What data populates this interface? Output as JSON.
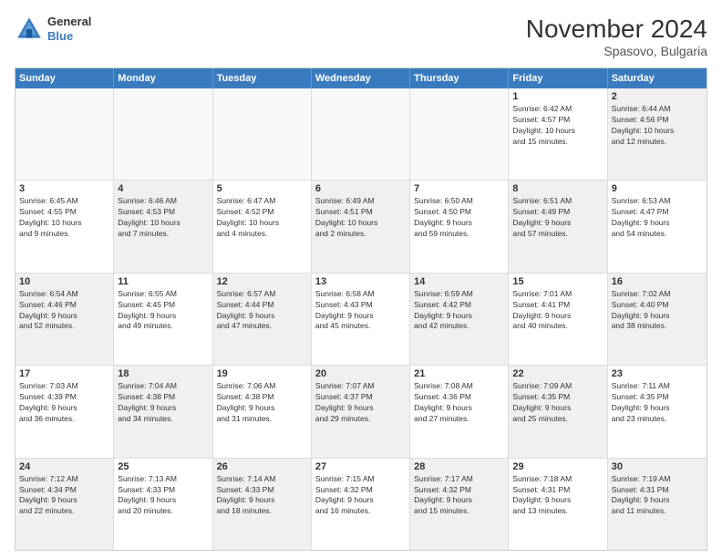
{
  "header": {
    "logo": {
      "general": "General",
      "blue": "Blue"
    },
    "title": "November 2024",
    "subtitle": "Spasovo, Bulgaria"
  },
  "weekdays": [
    "Sunday",
    "Monday",
    "Tuesday",
    "Wednesday",
    "Thursday",
    "Friday",
    "Saturday"
  ],
  "rows": [
    [
      {
        "day": "",
        "info": "",
        "empty": true
      },
      {
        "day": "",
        "info": "",
        "empty": true
      },
      {
        "day": "",
        "info": "",
        "empty": true
      },
      {
        "day": "",
        "info": "",
        "empty": true
      },
      {
        "day": "",
        "info": "",
        "empty": true
      },
      {
        "day": "1",
        "info": "Sunrise: 6:42 AM\nSunset: 4:57 PM\nDaylight: 10 hours\nand 15 minutes.",
        "empty": false
      },
      {
        "day": "2",
        "info": "Sunrise: 6:44 AM\nSunset: 4:56 PM\nDaylight: 10 hours\nand 12 minutes.",
        "empty": false,
        "shaded": true
      }
    ],
    [
      {
        "day": "3",
        "info": "Sunrise: 6:45 AM\nSunset: 4:55 PM\nDaylight: 10 hours\nand 9 minutes.",
        "empty": false
      },
      {
        "day": "4",
        "info": "Sunrise: 6:46 AM\nSunset: 4:53 PM\nDaylight: 10 hours\nand 7 minutes.",
        "empty": false,
        "shaded": true
      },
      {
        "day": "5",
        "info": "Sunrise: 6:47 AM\nSunset: 4:52 PM\nDaylight: 10 hours\nand 4 minutes.",
        "empty": false
      },
      {
        "day": "6",
        "info": "Sunrise: 6:49 AM\nSunset: 4:51 PM\nDaylight: 10 hours\nand 2 minutes.",
        "empty": false,
        "shaded": true
      },
      {
        "day": "7",
        "info": "Sunrise: 6:50 AM\nSunset: 4:50 PM\nDaylight: 9 hours\nand 59 minutes.",
        "empty": false
      },
      {
        "day": "8",
        "info": "Sunrise: 6:51 AM\nSunset: 4:49 PM\nDaylight: 9 hours\nand 57 minutes.",
        "empty": false,
        "shaded": true
      },
      {
        "day": "9",
        "info": "Sunrise: 6:53 AM\nSunset: 4:47 PM\nDaylight: 9 hours\nand 54 minutes.",
        "empty": false
      }
    ],
    [
      {
        "day": "10",
        "info": "Sunrise: 6:54 AM\nSunset: 4:46 PM\nDaylight: 9 hours\nand 52 minutes.",
        "empty": false,
        "shaded": true
      },
      {
        "day": "11",
        "info": "Sunrise: 6:55 AM\nSunset: 4:45 PM\nDaylight: 9 hours\nand 49 minutes.",
        "empty": false
      },
      {
        "day": "12",
        "info": "Sunrise: 6:57 AM\nSunset: 4:44 PM\nDaylight: 9 hours\nand 47 minutes.",
        "empty": false,
        "shaded": true
      },
      {
        "day": "13",
        "info": "Sunrise: 6:58 AM\nSunset: 4:43 PM\nDaylight: 9 hours\nand 45 minutes.",
        "empty": false
      },
      {
        "day": "14",
        "info": "Sunrise: 6:59 AM\nSunset: 4:42 PM\nDaylight: 9 hours\nand 42 minutes.",
        "empty": false,
        "shaded": true
      },
      {
        "day": "15",
        "info": "Sunrise: 7:01 AM\nSunset: 4:41 PM\nDaylight: 9 hours\nand 40 minutes.",
        "empty": false
      },
      {
        "day": "16",
        "info": "Sunrise: 7:02 AM\nSunset: 4:40 PM\nDaylight: 9 hours\nand 38 minutes.",
        "empty": false,
        "shaded": true
      }
    ],
    [
      {
        "day": "17",
        "info": "Sunrise: 7:03 AM\nSunset: 4:39 PM\nDaylight: 9 hours\nand 36 minutes.",
        "empty": false
      },
      {
        "day": "18",
        "info": "Sunrise: 7:04 AM\nSunset: 4:38 PM\nDaylight: 9 hours\nand 34 minutes.",
        "empty": false,
        "shaded": true
      },
      {
        "day": "19",
        "info": "Sunrise: 7:06 AM\nSunset: 4:38 PM\nDaylight: 9 hours\nand 31 minutes.",
        "empty": false
      },
      {
        "day": "20",
        "info": "Sunrise: 7:07 AM\nSunset: 4:37 PM\nDaylight: 9 hours\nand 29 minutes.",
        "empty": false,
        "shaded": true
      },
      {
        "day": "21",
        "info": "Sunrise: 7:08 AM\nSunset: 4:36 PM\nDaylight: 9 hours\nand 27 minutes.",
        "empty": false
      },
      {
        "day": "22",
        "info": "Sunrise: 7:09 AM\nSunset: 4:35 PM\nDaylight: 9 hours\nand 25 minutes.",
        "empty": false,
        "shaded": true
      },
      {
        "day": "23",
        "info": "Sunrise: 7:11 AM\nSunset: 4:35 PM\nDaylight: 9 hours\nand 23 minutes.",
        "empty": false
      }
    ],
    [
      {
        "day": "24",
        "info": "Sunrise: 7:12 AM\nSunset: 4:34 PM\nDaylight: 9 hours\nand 22 minutes.",
        "empty": false,
        "shaded": true
      },
      {
        "day": "25",
        "info": "Sunrise: 7:13 AM\nSunset: 4:33 PM\nDaylight: 9 hours\nand 20 minutes.",
        "empty": false
      },
      {
        "day": "26",
        "info": "Sunrise: 7:14 AM\nSunset: 4:33 PM\nDaylight: 9 hours\nand 18 minutes.",
        "empty": false,
        "shaded": true
      },
      {
        "day": "27",
        "info": "Sunrise: 7:15 AM\nSunset: 4:32 PM\nDaylight: 9 hours\nand 16 minutes.",
        "empty": false
      },
      {
        "day": "28",
        "info": "Sunrise: 7:17 AM\nSunset: 4:32 PM\nDaylight: 9 hours\nand 15 minutes.",
        "empty": false,
        "shaded": true
      },
      {
        "day": "29",
        "info": "Sunrise: 7:18 AM\nSunset: 4:31 PM\nDaylight: 9 hours\nand 13 minutes.",
        "empty": false
      },
      {
        "day": "30",
        "info": "Sunrise: 7:19 AM\nSunset: 4:31 PM\nDaylight: 9 hours\nand 11 minutes.",
        "empty": false,
        "shaded": true
      }
    ]
  ]
}
